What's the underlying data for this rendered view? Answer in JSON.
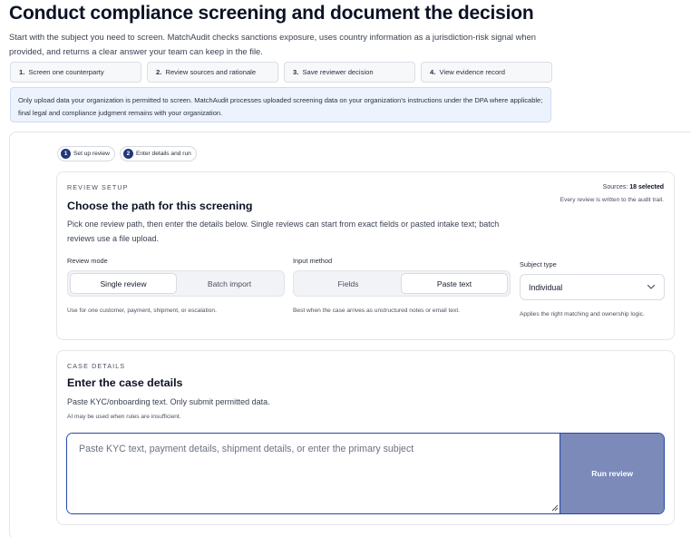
{
  "page": {
    "title": "Conduct compliance screening and document the decision",
    "intro": "Start with the subject you need to screen. MatchAudit checks sanctions exposure, uses country information as a jurisdiction-risk signal when provided, and returns a clear answer your team can keep in the file."
  },
  "steps": [
    {
      "num": "1.",
      "label": "Screen one counterparty"
    },
    {
      "num": "2.",
      "label": "Review sources and rationale"
    },
    {
      "num": "3.",
      "label": "Save reviewer decision"
    },
    {
      "num": "4.",
      "label": "View evidence record"
    }
  ],
  "notice": "Only upload data your organization is permitted to screen. MatchAudit processes uploaded screening data on your organization's instructions under the DPA where applicable; final legal and compliance judgment remains with your organization.",
  "progress": [
    {
      "num": "1",
      "label": "Set up review"
    },
    {
      "num": "2",
      "label": "Enter details and run"
    }
  ],
  "review_setup": {
    "eyebrow": "REVIEW SETUP",
    "title": "Choose the path for this screening",
    "description": "Pick one review path, then enter the details below. Single reviews can start from exact fields or pasted intake text; batch reviews use a file upload.",
    "sources_prefix": "Sources:",
    "sources_value": "18 selected",
    "audit_note": "Every review is written to the audit trail.",
    "review_mode": {
      "label": "Review mode",
      "options": [
        "Single review",
        "Batch import"
      ],
      "selected": "Single review",
      "help": "Use for one customer, payment, shipment, or escalation."
    },
    "input_method": {
      "label": "Input method",
      "options": [
        "Fields",
        "Paste text"
      ],
      "selected": "Paste text",
      "help": "Best when the case arrives as unstructured notes or email text."
    },
    "subject_type": {
      "label": "Subject type",
      "value": "Individual",
      "help": "Applies the right matching and ownership logic."
    }
  },
  "case_details": {
    "eyebrow": "CASE DETAILS",
    "title": "Enter the case details",
    "description": "Paste KYC/onboarding text. Only submit permitted data.",
    "ai_note": "AI may be used when rules are insufficient.",
    "placeholder": "Paste KYC text, payment details, shipment details, or enter the primary subject",
    "value": "",
    "run_label": "Run review"
  },
  "colors": {
    "accent": "#2848a8",
    "badge": "#22377a",
    "button_disabled": "#7b8ab9",
    "notice_bg": "#edf3fd"
  }
}
